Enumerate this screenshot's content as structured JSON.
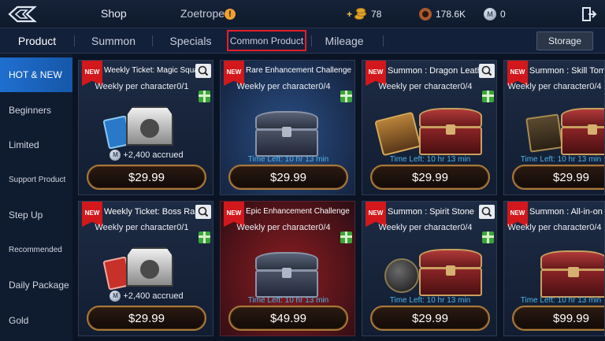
{
  "topbar": {
    "title": "Shop",
    "character_name": "Zoetrope",
    "alert_icon": "exclamation-icon",
    "currencies": [
      {
        "icon": "gold-coins-icon",
        "prefix": "+",
        "value": "78"
      },
      {
        "icon": "ring-icon",
        "value": "178.6K"
      },
      {
        "icon": "mileage-m-icon",
        "value": "0"
      }
    ]
  },
  "tabs": [
    {
      "label": "Product",
      "active": true
    },
    {
      "label": "Summon"
    },
    {
      "label": "Specials"
    },
    {
      "label": "Common Product",
      "highlighted": true
    },
    {
      "label": "Mileage"
    }
  ],
  "storage_label": "Storage",
  "sidebar": [
    {
      "label": "HOT & NEW",
      "active": true
    },
    {
      "label": "Beginners"
    },
    {
      "label": "Limited"
    },
    {
      "label": "Support Product"
    },
    {
      "label": "Step Up"
    },
    {
      "label": "Recommended"
    },
    {
      "label": "Daily Package"
    },
    {
      "label": "Gold"
    }
  ],
  "products": [
    {
      "badge": "NEW",
      "title": "Weekly Ticket: Magic Square",
      "limit": "Weekly per character0/1",
      "accrued": "+2,400 accrued",
      "price": "$29.99"
    },
    {
      "badge": "NEW",
      "title": "Rare Enhancement Challenge",
      "limit": "Weekly per character0/4",
      "time_left": "Time Left: 10 hr 13 min",
      "price": "$29.99"
    },
    {
      "badge": "NEW",
      "title": "Summon : Dragon Leather",
      "limit": "Weekly per character0/4",
      "time_left": "Time Left: 10 hr 13 min",
      "price": "$29.99"
    },
    {
      "badge": "NEW",
      "title": "Summon : Skill Tom",
      "limit": "Weekly per character0/4",
      "time_left": "Time Left: 10 hr 13 min",
      "price": "$29.99"
    },
    {
      "badge": "NEW",
      "title": "Weekly Ticket: Boss Raid",
      "limit": "Weekly per character0/1",
      "accrued": "+2,400 accrued",
      "price": "$29.99"
    },
    {
      "badge": "NEW",
      "title": "Epic Enhancement Challenge",
      "limit": "Weekly per character0/4",
      "time_left": "Time Left: 10 hr 13 min",
      "price": "$49.99"
    },
    {
      "badge": "NEW",
      "title": "Summon : Spirit Stone",
      "limit": "Weekly per character0/4",
      "time_left": "Time Left: 10 hr 13 min",
      "price": "$29.99"
    },
    {
      "badge": "NEW",
      "title": "Summon : All-in-on",
      "limit": "Weekly per character0/4",
      "time_left": "Time Left: 10 hr 13 min",
      "price": "$99.99"
    }
  ],
  "colors": {
    "accent_blue": "#1f6fd0",
    "highlight_red": "#e3202a",
    "new_badge": "#d2181c",
    "time_left": "#4fb3ea",
    "price_border": "#a9793a"
  }
}
